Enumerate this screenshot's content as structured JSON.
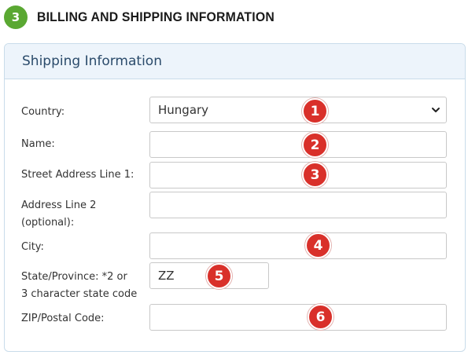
{
  "step": {
    "number": "3",
    "title": "BILLING AND SHIPPING INFORMATION"
  },
  "panel": {
    "title": "Shipping Information"
  },
  "fields": {
    "country": {
      "label": "Country:",
      "value": "Hungary"
    },
    "name": {
      "label": "Name:",
      "value": ""
    },
    "street1": {
      "label": "Street Address Line 1:",
      "value": ""
    },
    "line2": {
      "label_1": "Address Line 2",
      "label_2": "(optional):",
      "value": ""
    },
    "city": {
      "label": "City:",
      "value": ""
    },
    "state": {
      "label_1": "State/Province: *2 or",
      "label_2": "3 character state code",
      "value": "ZZ"
    },
    "zip": {
      "label": "ZIP/Postal Code:",
      "value": ""
    }
  },
  "markers": [
    "1",
    "2",
    "3",
    "4",
    "5",
    "6"
  ],
  "colors": {
    "step_green": "#5aa832",
    "marker_red": "#d9302a",
    "panel_header_bg": "#edf4fb"
  },
  "icons": {
    "country_select": "chevron-down-icon"
  }
}
